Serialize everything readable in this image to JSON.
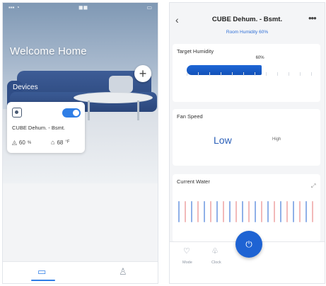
{
  "left_screen": {
    "welcome_title": "Welcome Home",
    "devices_label": "Devices",
    "device_card": {
      "name": "CUBE Dehum. - Bsmt.",
      "humidity": "60",
      "humidity_unit": "%",
      "temperature": "68",
      "temperature_unit": "°F",
      "power_on": true
    }
  },
  "right_screen": {
    "title": "CUBE Dehum. - Bsmt.",
    "room_humidity": "Room Humidity 60%",
    "target_humidity": {
      "label": "Target Humidity",
      "value_label": "60%",
      "value": 60
    },
    "fan_speed": {
      "label": "Fan Speed",
      "mode": "Low",
      "tag": "High"
    },
    "current_water": {
      "label": "Current Water"
    },
    "bottom_nav": [
      {
        "label": "Mode"
      },
      {
        "label": "Clock"
      }
    ]
  },
  "colors": {
    "accent": "#1e63d3",
    "toggle_on": "#2f7ee6"
  }
}
